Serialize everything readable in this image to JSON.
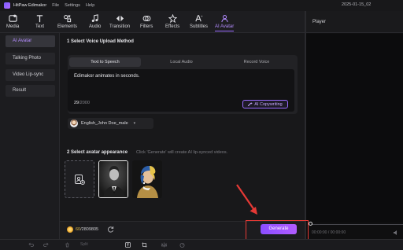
{
  "titlebar": {
    "app_name": "HitPaw Edimakor",
    "menu": [
      "File",
      "Settings",
      "Help"
    ],
    "date": "2025-01-15_02"
  },
  "toolbar": {
    "tools": [
      {
        "label": "Media",
        "icon": "media-icon"
      },
      {
        "label": "Text",
        "icon": "text-icon"
      },
      {
        "label": "Elements",
        "icon": "elements-icon"
      },
      {
        "label": "Audio",
        "icon": "audio-icon"
      },
      {
        "label": "Transition",
        "icon": "transition-icon"
      },
      {
        "label": "Filters",
        "icon": "filters-icon"
      },
      {
        "label": "Effects",
        "icon": "effects-icon"
      },
      {
        "label": "Subtitles",
        "icon": "subtitles-icon"
      },
      {
        "label": "AI Avatar",
        "icon": "ai-avatar-icon",
        "active": true
      }
    ]
  },
  "player": {
    "title": "Player",
    "time": "00:00:00 / 00:00:00"
  },
  "sidebar": {
    "items": [
      {
        "label": "AI Avatar",
        "active": true
      },
      {
        "label": "Talking Photo"
      },
      {
        "label": "Video Lip-sync"
      },
      {
        "label": "Result"
      }
    ]
  },
  "voice_section": {
    "title": "1 Select Voice Upload Method",
    "tabs": [
      "Text to Speech",
      "Local Audio",
      "Record Voice"
    ],
    "active_tab": "Text to Speech",
    "text_value": "Edimakor animates in seconds.",
    "char_count": "29",
    "char_limit": "/2000",
    "copywriting_label": "AI Copywriting",
    "voice_name": "English_John Doe_male"
  },
  "avatar_section": {
    "title": "2 Select avatar appearance",
    "hint": "Click 'Generate' will create AI lip-synced videos."
  },
  "footer": {
    "credits_used": "60",
    "credits_total": "/2809805",
    "generate_label": "Generate"
  },
  "timeline": {
    "split_label": "Split"
  },
  "colors": {
    "accent": "#9a6bff",
    "generate": "#8a4dff",
    "highlight": "#e53935"
  }
}
